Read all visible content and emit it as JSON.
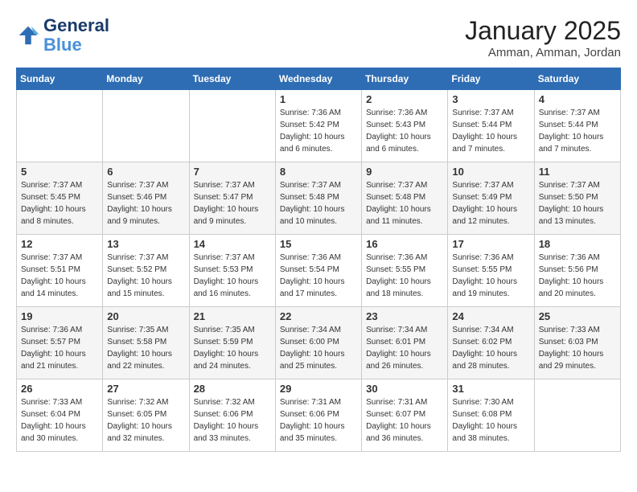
{
  "header": {
    "logo_line1": "General",
    "logo_line2": "Blue",
    "month_title": "January 2025",
    "location": "Amman, Amman, Jordan"
  },
  "weekdays": [
    "Sunday",
    "Monday",
    "Tuesday",
    "Wednesday",
    "Thursday",
    "Friday",
    "Saturday"
  ],
  "weeks": [
    [
      {
        "day": "",
        "sunrise": "",
        "sunset": "",
        "daylight": ""
      },
      {
        "day": "",
        "sunrise": "",
        "sunset": "",
        "daylight": ""
      },
      {
        "day": "",
        "sunrise": "",
        "sunset": "",
        "daylight": ""
      },
      {
        "day": "1",
        "sunrise": "Sunrise: 7:36 AM",
        "sunset": "Sunset: 5:42 PM",
        "daylight": "Daylight: 10 hours and 6 minutes."
      },
      {
        "day": "2",
        "sunrise": "Sunrise: 7:36 AM",
        "sunset": "Sunset: 5:43 PM",
        "daylight": "Daylight: 10 hours and 6 minutes."
      },
      {
        "day": "3",
        "sunrise": "Sunrise: 7:37 AM",
        "sunset": "Sunset: 5:44 PM",
        "daylight": "Daylight: 10 hours and 7 minutes."
      },
      {
        "day": "4",
        "sunrise": "Sunrise: 7:37 AM",
        "sunset": "Sunset: 5:44 PM",
        "daylight": "Daylight: 10 hours and 7 minutes."
      }
    ],
    [
      {
        "day": "5",
        "sunrise": "Sunrise: 7:37 AM",
        "sunset": "Sunset: 5:45 PM",
        "daylight": "Daylight: 10 hours and 8 minutes."
      },
      {
        "day": "6",
        "sunrise": "Sunrise: 7:37 AM",
        "sunset": "Sunset: 5:46 PM",
        "daylight": "Daylight: 10 hours and 9 minutes."
      },
      {
        "day": "7",
        "sunrise": "Sunrise: 7:37 AM",
        "sunset": "Sunset: 5:47 PM",
        "daylight": "Daylight: 10 hours and 9 minutes."
      },
      {
        "day": "8",
        "sunrise": "Sunrise: 7:37 AM",
        "sunset": "Sunset: 5:48 PM",
        "daylight": "Daylight: 10 hours and 10 minutes."
      },
      {
        "day": "9",
        "sunrise": "Sunrise: 7:37 AM",
        "sunset": "Sunset: 5:48 PM",
        "daylight": "Daylight: 10 hours and 11 minutes."
      },
      {
        "day": "10",
        "sunrise": "Sunrise: 7:37 AM",
        "sunset": "Sunset: 5:49 PM",
        "daylight": "Daylight: 10 hours and 12 minutes."
      },
      {
        "day": "11",
        "sunrise": "Sunrise: 7:37 AM",
        "sunset": "Sunset: 5:50 PM",
        "daylight": "Daylight: 10 hours and 13 minutes."
      }
    ],
    [
      {
        "day": "12",
        "sunrise": "Sunrise: 7:37 AM",
        "sunset": "Sunset: 5:51 PM",
        "daylight": "Daylight: 10 hours and 14 minutes."
      },
      {
        "day": "13",
        "sunrise": "Sunrise: 7:37 AM",
        "sunset": "Sunset: 5:52 PM",
        "daylight": "Daylight: 10 hours and 15 minutes."
      },
      {
        "day": "14",
        "sunrise": "Sunrise: 7:37 AM",
        "sunset": "Sunset: 5:53 PM",
        "daylight": "Daylight: 10 hours and 16 minutes."
      },
      {
        "day": "15",
        "sunrise": "Sunrise: 7:36 AM",
        "sunset": "Sunset: 5:54 PM",
        "daylight": "Daylight: 10 hours and 17 minutes."
      },
      {
        "day": "16",
        "sunrise": "Sunrise: 7:36 AM",
        "sunset": "Sunset: 5:55 PM",
        "daylight": "Daylight: 10 hours and 18 minutes."
      },
      {
        "day": "17",
        "sunrise": "Sunrise: 7:36 AM",
        "sunset": "Sunset: 5:55 PM",
        "daylight": "Daylight: 10 hours and 19 minutes."
      },
      {
        "day": "18",
        "sunrise": "Sunrise: 7:36 AM",
        "sunset": "Sunset: 5:56 PM",
        "daylight": "Daylight: 10 hours and 20 minutes."
      }
    ],
    [
      {
        "day": "19",
        "sunrise": "Sunrise: 7:36 AM",
        "sunset": "Sunset: 5:57 PM",
        "daylight": "Daylight: 10 hours and 21 minutes."
      },
      {
        "day": "20",
        "sunrise": "Sunrise: 7:35 AM",
        "sunset": "Sunset: 5:58 PM",
        "daylight": "Daylight: 10 hours and 22 minutes."
      },
      {
        "day": "21",
        "sunrise": "Sunrise: 7:35 AM",
        "sunset": "Sunset: 5:59 PM",
        "daylight": "Daylight: 10 hours and 24 minutes."
      },
      {
        "day": "22",
        "sunrise": "Sunrise: 7:34 AM",
        "sunset": "Sunset: 6:00 PM",
        "daylight": "Daylight: 10 hours and 25 minutes."
      },
      {
        "day": "23",
        "sunrise": "Sunrise: 7:34 AM",
        "sunset": "Sunset: 6:01 PM",
        "daylight": "Daylight: 10 hours and 26 minutes."
      },
      {
        "day": "24",
        "sunrise": "Sunrise: 7:34 AM",
        "sunset": "Sunset: 6:02 PM",
        "daylight": "Daylight: 10 hours and 28 minutes."
      },
      {
        "day": "25",
        "sunrise": "Sunrise: 7:33 AM",
        "sunset": "Sunset: 6:03 PM",
        "daylight": "Daylight: 10 hours and 29 minutes."
      }
    ],
    [
      {
        "day": "26",
        "sunrise": "Sunrise: 7:33 AM",
        "sunset": "Sunset: 6:04 PM",
        "daylight": "Daylight: 10 hours and 30 minutes."
      },
      {
        "day": "27",
        "sunrise": "Sunrise: 7:32 AM",
        "sunset": "Sunset: 6:05 PM",
        "daylight": "Daylight: 10 hours and 32 minutes."
      },
      {
        "day": "28",
        "sunrise": "Sunrise: 7:32 AM",
        "sunset": "Sunset: 6:06 PM",
        "daylight": "Daylight: 10 hours and 33 minutes."
      },
      {
        "day": "29",
        "sunrise": "Sunrise: 7:31 AM",
        "sunset": "Sunset: 6:06 PM",
        "daylight": "Daylight: 10 hours and 35 minutes."
      },
      {
        "day": "30",
        "sunrise": "Sunrise: 7:31 AM",
        "sunset": "Sunset: 6:07 PM",
        "daylight": "Daylight: 10 hours and 36 minutes."
      },
      {
        "day": "31",
        "sunrise": "Sunrise: 7:30 AM",
        "sunset": "Sunset: 6:08 PM",
        "daylight": "Daylight: 10 hours and 38 minutes."
      },
      {
        "day": "",
        "sunrise": "",
        "sunset": "",
        "daylight": ""
      }
    ]
  ]
}
